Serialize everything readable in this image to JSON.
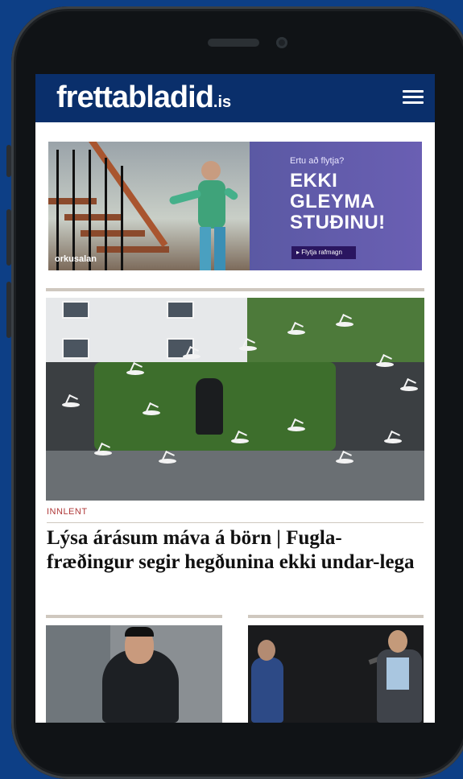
{
  "header": {
    "logo_main": "frettabladid",
    "logo_tld": ".is",
    "menu_icon": "hamburger-menu-icon"
  },
  "ad": {
    "tagline": "Ertu að flytja?",
    "headline_line1": "EKKI",
    "headline_line2": "GLEYMA",
    "headline_line3": "STUÐINU!",
    "button_label": "▸ Flytja rafmagn",
    "brand": "orkusalan"
  },
  "article": {
    "category": "INNLENT",
    "headline": "Lýsa árásum máva á börn | Fugla-fræðingur segir hegðunina ekki undar-lega"
  },
  "colors": {
    "header_bg": "#0a2f6b",
    "page_bg": "#0d3f86",
    "category": "#b03a3a"
  }
}
